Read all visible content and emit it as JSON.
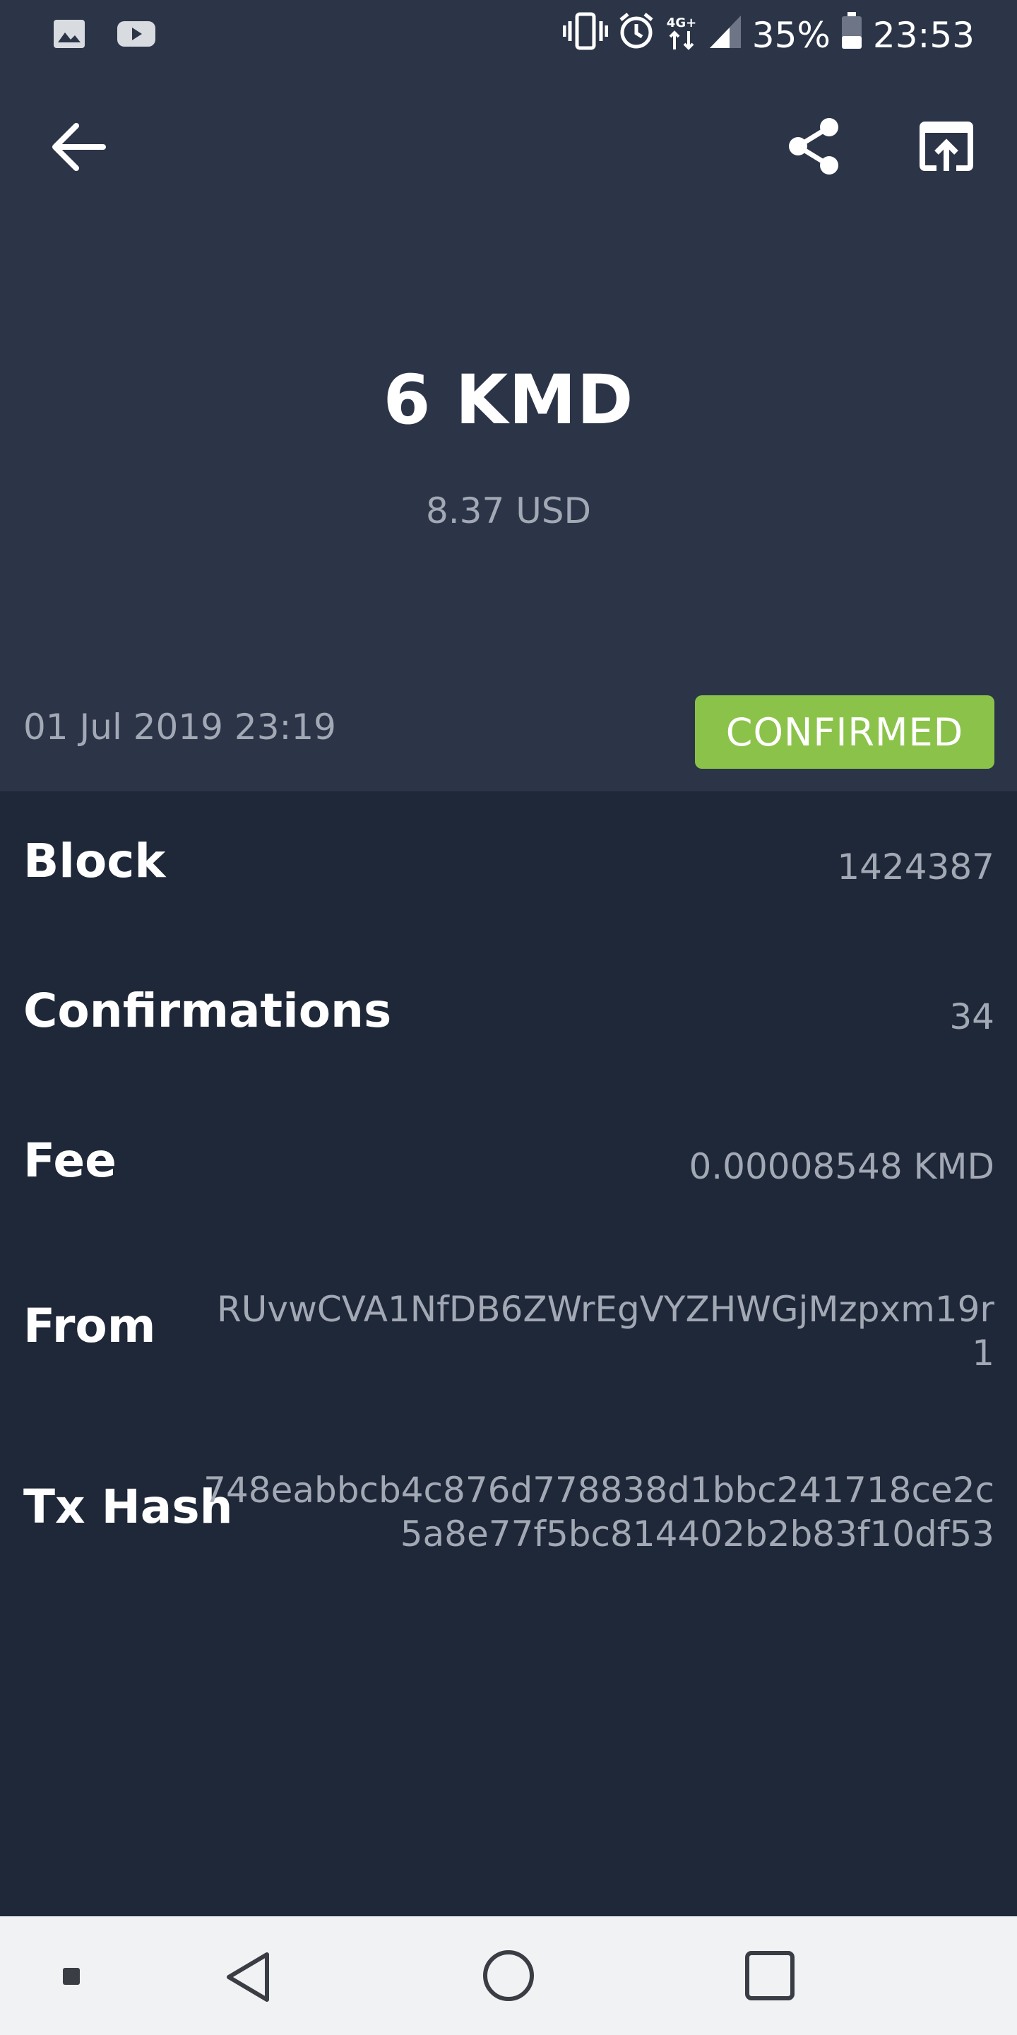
{
  "status_bar": {
    "left_icons": [
      "image-icon",
      "youtube-icon"
    ],
    "right_icons": [
      "vibrate-icon",
      "alarm-icon",
      "network-4g-icon",
      "signal-icon",
      "battery-icon"
    ],
    "network_label": "4G+",
    "battery": "35%",
    "time": "23:53"
  },
  "toolbar": {
    "back_icon": "arrow-left-icon",
    "share_icon": "share-icon",
    "open_icon": "open-external-icon"
  },
  "transaction": {
    "amount": "6 KMD",
    "fiat": "8.37 USD",
    "date": "01 Jul 2019 23:19",
    "status": "CONFIRMED"
  },
  "details": {
    "block_label": "Block",
    "block_value": "1424387",
    "confirmations_label": "Confirmations",
    "confirmations_value": "34",
    "fee_label": "Fee",
    "fee_value": "0.00008548 KMD",
    "from_label": "From",
    "from_value": "RUvwCVA1NfDB6ZWrEgVYZHWGjMzpxm19r1",
    "txhash_label": "Tx Hash",
    "txhash_value": "748eabbcb4c876d778838d1bbc241718ce2c5a8e77f5bc814402b2b83f10df53"
  },
  "colors": {
    "header_bg": "#2c3548",
    "body_bg": "#1f2839",
    "confirmed": "#8bc34a",
    "muted_text": "#a2a9b5"
  },
  "nav_bar": {
    "icons": [
      "dot-icon",
      "back-triangle-icon",
      "home-circle-icon",
      "recents-square-icon"
    ]
  }
}
